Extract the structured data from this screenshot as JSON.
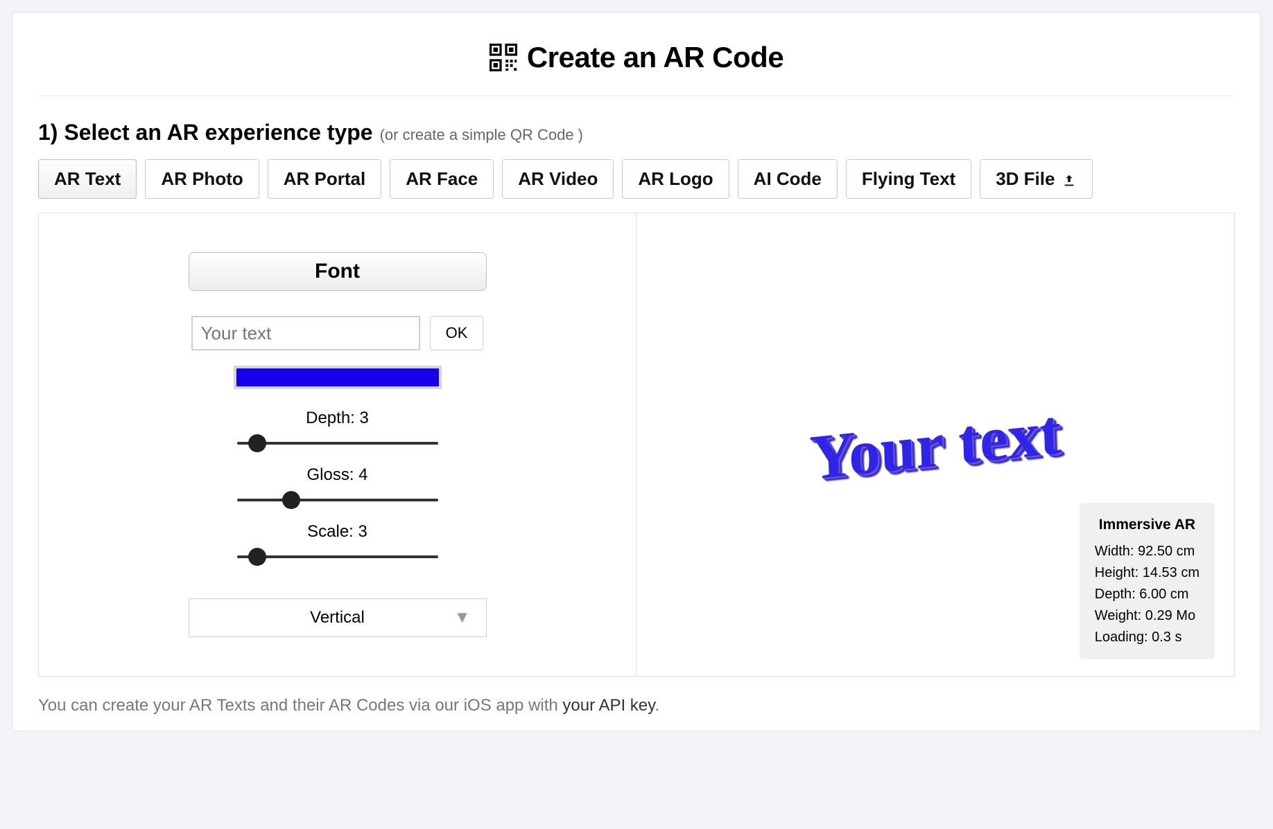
{
  "header": {
    "title": "Create an AR Code"
  },
  "step": {
    "label": "1) Select an AR experience type",
    "hint": "(or create a simple QR Code )"
  },
  "tabs": [
    {
      "label": "AR Text",
      "name": "tab-ar-text",
      "active": true
    },
    {
      "label": "AR Photo",
      "name": "tab-ar-photo",
      "active": false
    },
    {
      "label": "AR Portal",
      "name": "tab-ar-portal",
      "active": false
    },
    {
      "label": "AR Face",
      "name": "tab-ar-face",
      "active": false
    },
    {
      "label": "AR Video",
      "name": "tab-ar-video",
      "active": false
    },
    {
      "label": "AR Logo",
      "name": "tab-ar-logo",
      "active": false
    },
    {
      "label": "AI Code",
      "name": "tab-ai-code",
      "active": false
    },
    {
      "label": "Flying Text",
      "name": "tab-flying-text",
      "active": false
    },
    {
      "label": "3D File",
      "name": "tab-3d-file",
      "active": false,
      "upload": true
    }
  ],
  "form": {
    "font_button": "Font",
    "text_placeholder": "Your text",
    "text_value": "",
    "ok_label": "OK",
    "color_hex": "#1600ea",
    "depth": {
      "label": "Depth: 3",
      "pct": 10
    },
    "gloss": {
      "label": "Gloss: 4",
      "pct": 27
    },
    "scale": {
      "label": "Scale: 3",
      "pct": 10
    },
    "orientation_selected": "Vertical"
  },
  "preview": {
    "text": "Your text",
    "stats_title": "Immersive AR",
    "width": "Width:  92.50  cm",
    "height": "Height:   14.53  cm",
    "depth": "Depth:  6.00  cm",
    "weight": "Weight:   0.29 Mo",
    "loading": "Loading:  0.3 s"
  },
  "footer": {
    "prefix": "You can create your AR Texts and their AR Codes via our iOS app with ",
    "link_text": "your API key",
    "suffix": "."
  }
}
